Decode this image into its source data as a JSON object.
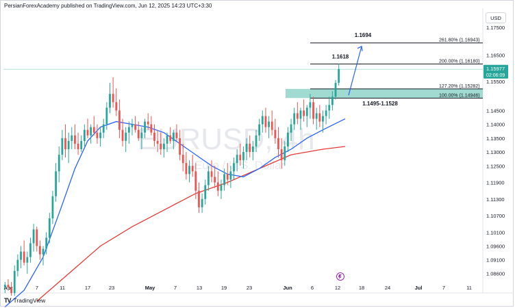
{
  "header": {
    "publisher_line": "PersianForexAcademy published on TradingView.com, Jun 12, 2025 14:23 UTC+3:30"
  },
  "currency_label": "USD",
  "watermark": {
    "symbol": "EURUSD, 4h",
    "name": "Euro / U.S. Dollar"
  },
  "footer": {
    "brand": "TradingView",
    "logo_glyph": "TV"
  },
  "price_tag": {
    "price": "1.15977",
    "countdown": "02:06:09"
  },
  "colors": {
    "up": "#26a69a",
    "down": "#ef5350",
    "ma_fast": "#2962ff",
    "ma_slow": "#e53935",
    "zone": "#8fd3c8",
    "arrow": "#2962ff",
    "price_line": "#b2dfdb",
    "badge_bg": "#26a69a"
  },
  "chart_data": {
    "type": "candlestick",
    "y_axis": {
      "ticks": [
        1.175,
        1.165,
        1.1555,
        1.1495,
        1.145,
        1.14,
        1.135,
        1.13,
        1.125,
        1.119,
        1.113,
        1.107,
        1.101,
        1.096,
        1.091,
        1.0861
      ],
      "tick_labels": [
        "1.17500",
        "1.16500",
        "1.15500",
        "1.14500",
        "1.14500",
        "1.14000",
        "1.13500",
        "1.13000",
        "1.12500",
        "1.11900",
        "1.11300",
        "1.10700",
        "1.10100",
        "1.09600",
        "1.09100",
        "1.08600"
      ],
      "visible_ticks": [
        {
          "v": 1.175,
          "label": "1.17500"
        },
        {
          "v": 1.165,
          "label": "1.16500"
        },
        {
          "v": 1.1555,
          "label": "1.15500"
        },
        {
          "v": 1.145,
          "label": "1.14500"
        },
        {
          "v": 1.14,
          "label": "1.14000"
        },
        {
          "v": 1.135,
          "label": "1.13500"
        },
        {
          "v": 1.13,
          "label": "1.13000"
        },
        {
          "v": 1.125,
          "label": "1.12500"
        },
        {
          "v": 1.119,
          "label": "1.11900"
        },
        {
          "v": 1.113,
          "label": "1.11300"
        },
        {
          "v": 1.107,
          "label": "1.10700"
        },
        {
          "v": 1.101,
          "label": "1.10100"
        },
        {
          "v": 1.096,
          "label": "1.09600"
        },
        {
          "v": 1.091,
          "label": "1.09100"
        },
        {
          "v": 1.0861,
          "label": "1.08600"
        }
      ],
      "range": [
        1.083,
        1.1795
      ]
    },
    "x_axis": {
      "labels": [
        "Apr",
        "7",
        "11",
        "17",
        "23",
        "May",
        "7",
        "13",
        "19",
        "23",
        "Jun",
        "6",
        "12",
        "18",
        "24",
        "Jul",
        "7",
        "11"
      ],
      "bold_labels": [
        "Apr",
        "May",
        "Jun",
        "Jul"
      ]
    },
    "fibonacci": [
      {
        "ratio": "261.80%",
        "price": 1.16943,
        "label": "261.80% (1.16943)"
      },
      {
        "ratio": "200.00%",
        "price": 1.1618,
        "label": "200.00% (1.16180)"
      },
      {
        "ratio": "127.20%",
        "price": 1.15282,
        "label": "127.20% (1.15282)"
      },
      {
        "ratio": "100.00%",
        "price": 1.14946,
        "label": "100.00% (1.14946)"
      }
    ],
    "annotations": [
      {
        "text": "1.1694",
        "price": 1.1694
      },
      {
        "text": "1.1618",
        "price": 1.1618
      },
      {
        "text": "1.1495-1.1528",
        "zone": [
          1.1495,
          1.1528
        ]
      }
    ],
    "candles": [
      [
        1.081,
        1.083,
        1.079,
        1.082
      ],
      [
        1.082,
        1.084,
        1.08,
        1.081
      ],
      [
        1.081,
        1.083,
        1.078,
        1.079
      ],
      [
        1.079,
        1.089,
        1.078,
        1.087
      ],
      [
        1.087,
        1.093,
        1.085,
        1.091
      ],
      [
        1.091,
        1.096,
        1.088,
        1.094
      ],
      [
        1.094,
        1.098,
        1.089,
        1.09
      ],
      [
        1.09,
        1.094,
        1.086,
        1.092
      ],
      [
        1.092,
        1.099,
        1.09,
        1.097
      ],
      [
        1.097,
        1.104,
        1.094,
        1.102
      ],
      [
        1.102,
        1.103,
        1.094,
        1.096
      ],
      [
        1.096,
        1.098,
        1.091,
        1.093
      ],
      [
        1.093,
        1.096,
        1.089,
        1.095
      ],
      [
        1.095,
        1.101,
        1.093,
        1.099
      ],
      [
        1.099,
        1.108,
        1.097,
        1.106
      ],
      [
        1.106,
        1.116,
        1.104,
        1.114
      ],
      [
        1.114,
        1.126,
        1.112,
        1.123
      ],
      [
        1.123,
        1.132,
        1.119,
        1.129
      ],
      [
        1.129,
        1.138,
        1.127,
        1.135
      ],
      [
        1.135,
        1.14,
        1.128,
        1.131
      ],
      [
        1.131,
        1.137,
        1.126,
        1.134
      ],
      [
        1.134,
        1.139,
        1.131,
        1.136
      ],
      [
        1.136,
        1.14,
        1.131,
        1.133
      ],
      [
        1.133,
        1.137,
        1.129,
        1.131
      ],
      [
        1.131,
        1.136,
        1.13,
        1.134
      ],
      [
        1.134,
        1.14,
        1.132,
        1.138
      ],
      [
        1.138,
        1.142,
        1.135,
        1.136
      ],
      [
        1.136,
        1.14,
        1.133,
        1.139
      ],
      [
        1.139,
        1.143,
        1.136,
        1.137
      ],
      [
        1.137,
        1.14,
        1.133,
        1.135
      ],
      [
        1.135,
        1.139,
        1.132,
        1.137
      ],
      [
        1.137,
        1.142,
        1.135,
        1.14
      ],
      [
        1.14,
        1.148,
        1.138,
        1.146
      ],
      [
        1.146,
        1.155,
        1.144,
        1.151
      ],
      [
        1.151,
        1.157,
        1.146,
        1.148
      ],
      [
        1.148,
        1.153,
        1.143,
        1.145
      ],
      [
        1.145,
        1.149,
        1.135,
        1.138
      ],
      [
        1.138,
        1.142,
        1.132,
        1.134
      ],
      [
        1.134,
        1.139,
        1.13,
        1.137
      ],
      [
        1.137,
        1.141,
        1.133,
        1.139
      ],
      [
        1.139,
        1.142,
        1.136,
        1.14
      ],
      [
        1.14,
        1.143,
        1.137,
        1.138
      ],
      [
        1.138,
        1.141,
        1.134,
        1.135
      ],
      [
        1.135,
        1.139,
        1.131,
        1.137
      ],
      [
        1.137,
        1.142,
        1.135,
        1.141
      ],
      [
        1.141,
        1.144,
        1.138,
        1.14
      ],
      [
        1.14,
        1.143,
        1.136,
        1.137
      ],
      [
        1.137,
        1.14,
        1.132,
        1.134
      ],
      [
        1.134,
        1.138,
        1.13,
        1.133
      ],
      [
        1.133,
        1.137,
        1.129,
        1.131
      ],
      [
        1.131,
        1.135,
        1.128,
        1.133
      ],
      [
        1.133,
        1.137,
        1.13,
        1.136
      ],
      [
        1.136,
        1.139,
        1.133,
        1.134
      ],
      [
        1.134,
        1.138,
        1.131,
        1.137
      ],
      [
        1.137,
        1.14,
        1.134,
        1.135
      ],
      [
        1.135,
        1.138,
        1.127,
        1.129
      ],
      [
        1.129,
        1.133,
        1.123,
        1.126
      ],
      [
        1.126,
        1.13,
        1.12,
        1.122
      ],
      [
        1.122,
        1.127,
        1.119,
        1.125
      ],
      [
        1.125,
        1.129,
        1.121,
        1.123
      ],
      [
        1.123,
        1.126,
        1.113,
        1.116
      ],
      [
        1.116,
        1.119,
        1.108,
        1.11
      ],
      [
        1.11,
        1.115,
        1.108,
        1.113
      ],
      [
        1.113,
        1.12,
        1.111,
        1.118
      ],
      [
        1.118,
        1.125,
        1.116,
        1.123
      ],
      [
        1.123,
        1.127,
        1.119,
        1.121
      ],
      [
        1.121,
        1.125,
        1.117,
        1.119
      ],
      [
        1.119,
        1.123,
        1.114,
        1.116
      ],
      [
        1.116,
        1.12,
        1.113,
        1.118
      ],
      [
        1.118,
        1.124,
        1.116,
        1.122
      ],
      [
        1.122,
        1.126,
        1.118,
        1.12
      ],
      [
        1.12,
        1.125,
        1.117,
        1.123
      ],
      [
        1.123,
        1.128,
        1.12,
        1.126
      ],
      [
        1.126,
        1.131,
        1.123,
        1.129
      ],
      [
        1.129,
        1.133,
        1.125,
        1.127
      ],
      [
        1.127,
        1.132,
        1.124,
        1.13
      ],
      [
        1.13,
        1.135,
        1.127,
        1.133
      ],
      [
        1.133,
        1.136,
        1.128,
        1.13
      ],
      [
        1.13,
        1.134,
        1.127,
        1.132
      ],
      [
        1.132,
        1.138,
        1.13,
        1.136
      ],
      [
        1.136,
        1.142,
        1.134,
        1.14
      ],
      [
        1.14,
        1.145,
        1.137,
        1.143
      ],
      [
        1.143,
        1.146,
        1.137,
        1.139
      ],
      [
        1.139,
        1.143,
        1.135,
        1.141
      ],
      [
        1.141,
        1.145,
        1.136,
        1.138
      ],
      [
        1.138,
        1.142,
        1.133,
        1.135
      ],
      [
        1.135,
        1.139,
        1.128,
        1.131
      ],
      [
        1.131,
        1.135,
        1.124,
        1.127
      ],
      [
        1.127,
        1.134,
        1.125,
        1.132
      ],
      [
        1.132,
        1.139,
        1.13,
        1.137
      ],
      [
        1.137,
        1.142,
        1.134,
        1.14
      ],
      [
        1.14,
        1.146,
        1.138,
        1.144
      ],
      [
        1.144,
        1.148,
        1.14,
        1.142
      ],
      [
        1.142,
        1.146,
        1.138,
        1.145
      ],
      [
        1.145,
        1.149,
        1.141,
        1.143
      ],
      [
        1.143,
        1.147,
        1.139,
        1.146
      ],
      [
        1.146,
        1.151,
        1.142,
        1.148
      ],
      [
        1.148,
        1.15,
        1.14,
        1.142
      ],
      [
        1.142,
        1.146,
        1.138,
        1.144
      ],
      [
        1.144,
        1.147,
        1.139,
        1.141
      ],
      [
        1.141,
        1.145,
        1.137,
        1.143
      ],
      [
        1.143,
        1.147,
        1.14,
        1.145
      ],
      [
        1.145,
        1.15,
        1.142,
        1.147
      ],
      [
        1.147,
        1.152,
        1.145,
        1.15
      ],
      [
        1.15,
        1.156,
        1.149,
        1.155
      ],
      [
        1.155,
        1.162,
        1.154,
        1.16
      ]
    ],
    "ma_fast": [
      [
        0,
        1.074
      ],
      [
        6,
        1.08
      ],
      [
        12,
        1.092
      ],
      [
        18,
        1.111
      ],
      [
        22,
        1.124
      ],
      [
        26,
        1.134
      ],
      [
        30,
        1.139
      ],
      [
        35,
        1.141
      ],
      [
        40,
        1.14
      ],
      [
        45,
        1.139
      ],
      [
        50,
        1.137
      ],
      [
        55,
        1.133
      ],
      [
        60,
        1.129
      ],
      [
        65,
        1.125
      ],
      [
        70,
        1.122
      ],
      [
        75,
        1.121
      ],
      [
        80,
        1.124
      ],
      [
        85,
        1.128
      ],
      [
        90,
        1.131
      ],
      [
        95,
        1.135
      ],
      [
        100,
        1.138
      ],
      [
        107,
        1.142
      ]
    ],
    "ma_slow": [
      [
        10,
        1.076
      ],
      [
        20,
        1.086
      ],
      [
        30,
        1.096
      ],
      [
        40,
        1.103
      ],
      [
        50,
        1.109
      ],
      [
        60,
        1.115
      ],
      [
        70,
        1.119
      ],
      [
        80,
        1.124
      ],
      [
        90,
        1.129
      ],
      [
        100,
        1.131
      ],
      [
        107,
        1.132
      ]
    ]
  }
}
